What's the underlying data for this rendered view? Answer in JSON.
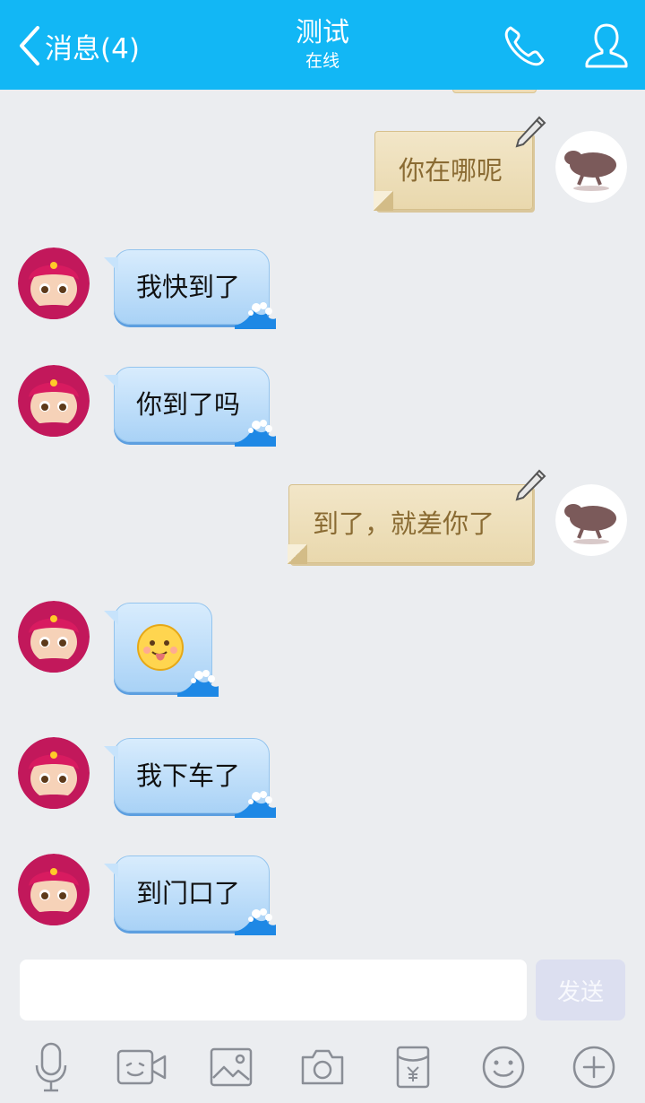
{
  "header": {
    "back_label": "消息(4)",
    "title": "测试",
    "status": "在线"
  },
  "messages": [
    {
      "side": "out",
      "type": "text",
      "text": "你在哪呢"
    },
    {
      "side": "in",
      "type": "text",
      "text": "我快到了"
    },
    {
      "side": "in",
      "type": "text",
      "text": "你到了吗"
    },
    {
      "side": "out",
      "type": "text",
      "text": "到了，就差你了"
    },
    {
      "side": "in",
      "type": "emoji",
      "emoji": "tongue-out-face"
    },
    {
      "side": "in",
      "type": "text",
      "text": "我下车了"
    },
    {
      "side": "in",
      "type": "text",
      "text": "到门口了"
    }
  ],
  "composer": {
    "input_value": "",
    "send_label": "发送"
  },
  "toolbar": {
    "items": [
      "microphone-icon",
      "video-call-icon",
      "image-icon",
      "camera-icon",
      "red-packet-icon",
      "emoji-icon",
      "plus-icon"
    ]
  },
  "colors": {
    "header_bg": "#12b7f5",
    "background": "#ebedf0",
    "incoming_bubble": "#b9dcf9",
    "outgoing_bubble": "#ecdcb7",
    "send_button_disabled": "#dcdff0"
  }
}
